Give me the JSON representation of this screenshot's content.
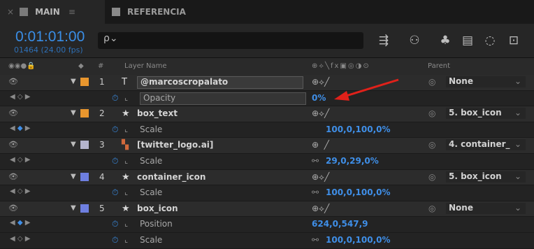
{
  "tabs": [
    {
      "label": "MAIN",
      "color": "#7a7a7a",
      "close": "×",
      "menu": "≡"
    },
    {
      "label": "REFERENCIA",
      "color": "#8a8a8a"
    }
  ],
  "toolbar": {
    "timecode": "0:01:01:00",
    "frames": "01464 (24.00 fps)",
    "search_placeholder": "ρ⌄"
  },
  "header": {
    "layer_name": "Layer Name",
    "parent": "Parent",
    "hash": "#",
    "switches": "⊕⟡╲fx▣◎◑⊙"
  },
  "layers": [
    {
      "num": "1",
      "type_icon": "T",
      "name": "@marcoscropalato",
      "color": "#e8962e",
      "parent": "None",
      "prop": "Opacity",
      "value": "0%"
    },
    {
      "num": "2",
      "type_icon": "★",
      "name": "box_text",
      "color": "#e8962e",
      "parent": "5. box_icon",
      "prop": "Scale",
      "value": "100,0,100,0%"
    },
    {
      "num": "3",
      "type_icon": "▚",
      "name": "[twitter_logo.ai]",
      "color": "#b5b5ce",
      "parent": "4. container_",
      "prop": "Scale",
      "value": "29,0,29,0%"
    },
    {
      "num": "4",
      "type_icon": "★",
      "name": "container_icon",
      "color": "#6e7fe0",
      "parent": "5. box_icon",
      "prop": "Scale",
      "value": "100,0,100,0%"
    },
    {
      "num": "5",
      "type_icon": "★",
      "name": "box_icon",
      "color": "#6e7fe0",
      "parent": "None",
      "props": [
        {
          "prop": "Position",
          "value": "624,0,547,9"
        },
        {
          "prop": "Scale",
          "value": "100,0,100,0%"
        }
      ]
    }
  ],
  "colors": {
    "accent": "#3a8ee6",
    "arrow": "#e0211a"
  }
}
